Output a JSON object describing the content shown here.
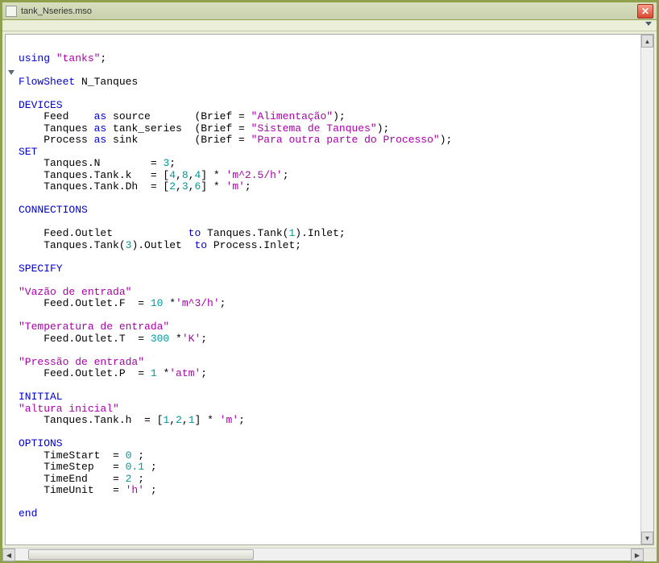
{
  "window": {
    "title": "tank_Nseries.mso"
  },
  "code": {
    "l1a": "using ",
    "l1b": "\"tanks\"",
    "l1c": ";",
    "l2a": "FlowSheet",
    "l2b": " N_Tanques",
    "l3": "DEVICES",
    "l4a": "    Feed    ",
    "l4b": "as",
    "l4c": " source       (Brief = ",
    "l4d": "\"Alimentação\"",
    "l4e": ");",
    "l5a": "    Tanques ",
    "l5b": "as",
    "l5c": " tank_series  (Brief = ",
    "l5d": "\"Sistema de Tanques\"",
    "l5e": ");",
    "l6a": "    Process ",
    "l6b": "as",
    "l6c": " sink         (Brief = ",
    "l6d": "\"Para outra parte do Processo\"",
    "l6e": ");",
    "l7": "SET",
    "l8a": "    Tanques.N        = ",
    "l8b": "3",
    "l8c": ";",
    "l9a": "    Tanques.Tank.k   = [",
    "l9b": "4",
    "l9c": ",",
    "l9d": "8",
    "l9e": ",",
    "l9f": "4",
    "l9g": "] * ",
    "l9h": "'m^2.5/h'",
    "l9i": ";",
    "l10a": "    Tanques.Tank.Dh  = [",
    "l10b": "2",
    "l10c": ",",
    "l10d": "3",
    "l10e": ",",
    "l10f": "6",
    "l10g": "] * ",
    "l10h": "'m'",
    "l10i": ";",
    "l11": "CONNECTIONS",
    "l12a": "    Feed.Outlet            ",
    "l12b": "to",
    "l12c": " Tanques.Tank(",
    "l12d": "1",
    "l12e": ").Inlet;",
    "l13a": "    Tanques.Tank(",
    "l13b": "3",
    "l13c": ").Outlet  ",
    "l13d": "to",
    "l13e": " Process.Inlet;",
    "l14": "SPECIFY",
    "l15": "\"Vazão de entrada\"",
    "l16a": "    Feed.Outlet.F  = ",
    "l16b": "10",
    "l16c": " *",
    "l16d": "'m^3/h'",
    "l16e": ";",
    "l17": "\"Temperatura de entrada\"",
    "l18a": "    Feed.Outlet.T  = ",
    "l18b": "300",
    "l18c": " *",
    "l18d": "'K'",
    "l18e": ";",
    "l19": "\"Pressão de entrada\"",
    "l20a": "    Feed.Outlet.P  = ",
    "l20b": "1",
    "l20c": " *",
    "l20d": "'atm'",
    "l20e": ";",
    "l21": "INITIAL",
    "l22": "\"altura inicial\"",
    "l23a": "    Tanques.Tank.h  = [",
    "l23b": "1",
    "l23c": ",",
    "l23d": "2",
    "l23e": ",",
    "l23f": "1",
    "l23g": "] * ",
    "l23h": "'m'",
    "l23i": ";",
    "l24": "OPTIONS",
    "l25a": "    TimeStart  = ",
    "l25b": "0",
    "l25c": " ;",
    "l26a": "    TimeStep   = ",
    "l26b": "0.1",
    "l26c": " ;",
    "l27a": "    TimeEnd    = ",
    "l27b": "2",
    "l27c": " ;",
    "l28a": "    TimeUnit   = ",
    "l28b": "'h'",
    "l28c": " ;",
    "l29": "end"
  }
}
